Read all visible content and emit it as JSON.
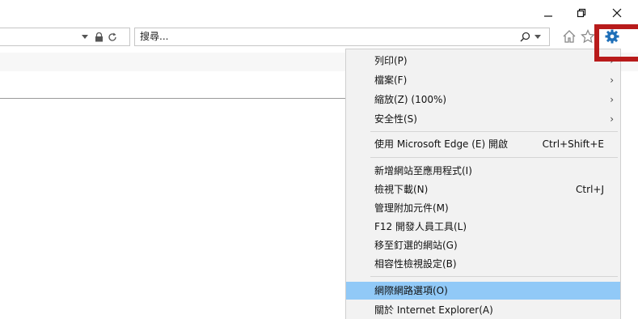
{
  "window": {
    "minimize_icon": "minimize-icon",
    "restore_icon": "restore-icon",
    "close_icon": "close-icon"
  },
  "address_bar": {
    "icons": [
      "dropdown-icon",
      "lock-icon",
      "refresh-icon"
    ]
  },
  "search": {
    "value": "搜尋...",
    "icons": [
      "search-icon",
      "dropdown-icon"
    ]
  },
  "toolbar": {
    "icons": [
      "home-icon",
      "favorites-icon",
      "gear-icon"
    ]
  },
  "menu": {
    "items": [
      {
        "label": "列印(P)",
        "shortcut": "",
        "submenu": true
      },
      {
        "label": "檔案(F)",
        "shortcut": "",
        "submenu": true
      },
      {
        "label": "縮放(Z) (100%)",
        "shortcut": "",
        "submenu": true
      },
      {
        "label": "安全性(S)",
        "shortcut": "",
        "submenu": true
      },
      {
        "label": "使用 Microsoft Edge (E) 開啟",
        "shortcut": "Ctrl+Shift+E",
        "submenu": false
      },
      {
        "label": "新增網站至應用程式(I)",
        "shortcut": "",
        "submenu": false
      },
      {
        "label": "檢視下載(N)",
        "shortcut": "Ctrl+J",
        "submenu": false
      },
      {
        "label": "管理附加元件(M)",
        "shortcut": "",
        "submenu": false
      },
      {
        "label": "F12 開發人員工具(L)",
        "shortcut": "",
        "submenu": false
      },
      {
        "label": "移至釘選的網站(G)",
        "shortcut": "",
        "submenu": false
      },
      {
        "label": "相容性檢視設定(B)",
        "shortcut": "",
        "submenu": false
      },
      {
        "label": "網際網路選項(O)",
        "shortcut": "",
        "submenu": false,
        "highlighted": true
      },
      {
        "label": "關於 Internet Explorer(A)",
        "shortcut": "",
        "submenu": false
      }
    ],
    "submenu_arrow": "›"
  },
  "colors": {
    "highlight": "#91c9f7",
    "annotation": "#b81b1b",
    "gear": "#1e6fb8"
  }
}
